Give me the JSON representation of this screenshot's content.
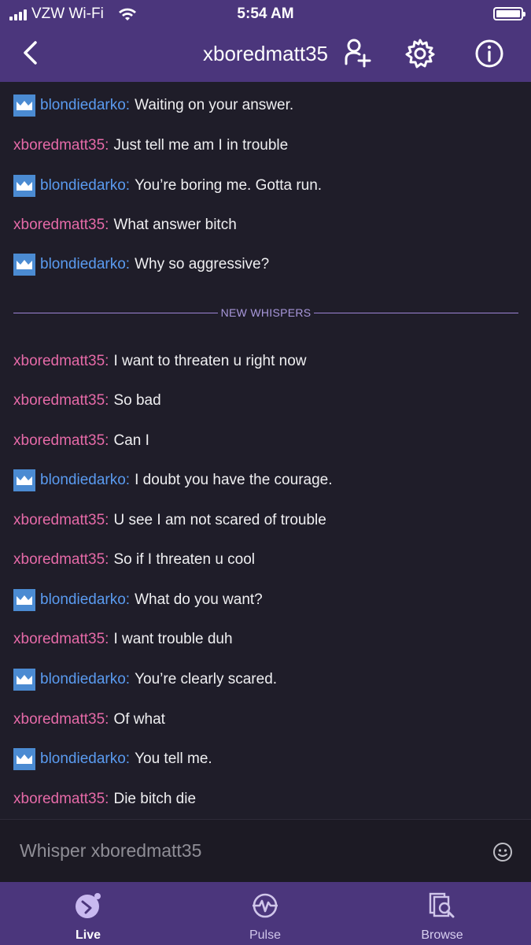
{
  "status": {
    "carrier": "VZW Wi-Fi",
    "time": "5:54 AM"
  },
  "header": {
    "title": "xboredmatt35"
  },
  "messages": [
    {
      "user": "blondiedarko:",
      "text": "Waiting on your answer.",
      "badge": true
    },
    {
      "user": "xboredmatt35:",
      "text": "Just tell me am I in trouble",
      "badge": false
    },
    {
      "user": "blondiedarko:",
      "text": "You’re boring me. Gotta run.",
      "badge": true
    },
    {
      "user": "xboredmatt35:",
      "text": "What answer bitch",
      "badge": false
    },
    {
      "user": "blondiedarko:",
      "text": "Why so aggressive?",
      "badge": true
    },
    {
      "user": "xboredmatt35:",
      "text": "I want to threaten u right now",
      "badge": false
    },
    {
      "user": "xboredmatt35:",
      "text": "So bad",
      "badge": false
    },
    {
      "user": "xboredmatt35:",
      "text": "Can I",
      "badge": false
    },
    {
      "user": "blondiedarko:",
      "text": "I doubt you have the courage.",
      "badge": true
    },
    {
      "user": "xboredmatt35:",
      "text": "U see I am not scared of trouble",
      "badge": false
    },
    {
      "user": "xboredmatt35:",
      "text": "So if I threaten u cool",
      "badge": false
    },
    {
      "user": "blondiedarko:",
      "text": "What do you want?",
      "badge": true
    },
    {
      "user": "xboredmatt35:",
      "text": "I want trouble duh",
      "badge": false
    },
    {
      "user": "blondiedarko:",
      "text": "You’re clearly scared.",
      "badge": true
    },
    {
      "user": "xboredmatt35:",
      "text": "Of what",
      "badge": false
    },
    {
      "user": "blondiedarko:",
      "text": "You tell me.",
      "badge": true
    },
    {
      "user": "xboredmatt35:",
      "text": "Die bitch die",
      "badge": false
    }
  ],
  "divider_label": "NEW WHISPERS",
  "composer": {
    "placeholder": "Whisper xboredmatt35"
  },
  "tabs": [
    {
      "label": "Live",
      "icon": "live-icon"
    },
    {
      "label": "Pulse",
      "icon": "pulse-icon"
    },
    {
      "label": "Browse",
      "icon": "browse-icon"
    }
  ],
  "colors": {
    "header": "#4b367c",
    "background": "#1f1d29",
    "blondiedarko": "#5a9bf0",
    "xboredmatt35": "#e66aa8",
    "badge": "#4b8bd2"
  }
}
